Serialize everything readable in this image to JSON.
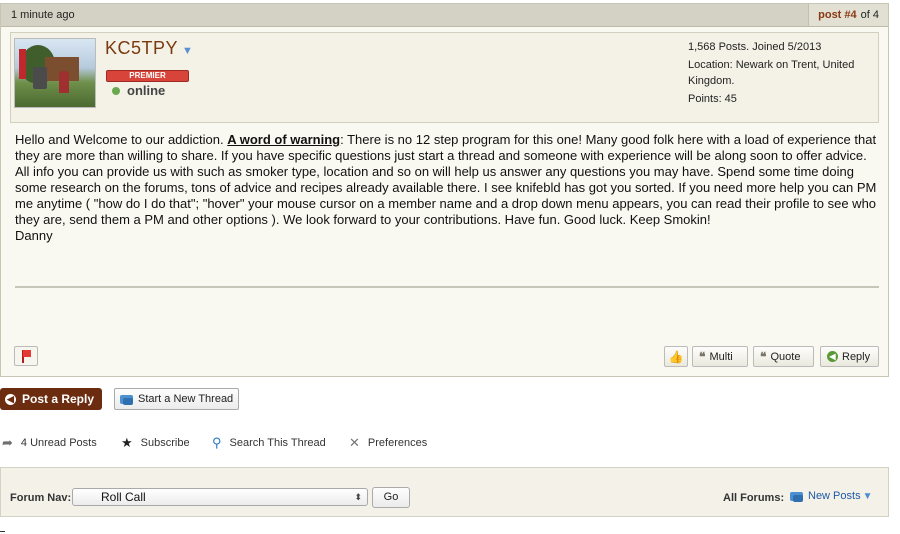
{
  "post": {
    "time_ago": "1 minute ago",
    "post_label": "post #4",
    "post_of": "of 4"
  },
  "user": {
    "name": "KC5TPY",
    "badge": "PREMIER",
    "status": "online",
    "posts_joined": "1,568 Posts. Joined 5/2013",
    "location": "Location: Newark on Trent, United Kingdom.",
    "points": "Points: 45"
  },
  "body": {
    "intro": "Hello and Welcome to our addiction.  ",
    "warning_link": "A word of warning",
    "text": ": There is no 12 step program for this one!  Many good folk here with a load of experience that they are more than willing to share.  If you have specific questions just start a thread and someone with experience will be along soon to offer advice.  All info you can provide us with such as smoker type, location and so on will help us answer any questions you may have.  Spend some time doing some research on the forums, tons of advice and recipes already available there.  I see knifebld has got you sorted.  If you need more help you can PM me anytime ( \"how do I do that\";  \"hover\" your mouse cursor on a member name and a drop down menu appears, you can read their profile to see who they are, send them a PM and other options ).  We look forward to your contributions.  Have fun.  Good luck.  Keep Smokin!",
    "signoff": "Danny"
  },
  "toolbar": {
    "multi": "Multi",
    "quote": "Quote",
    "reply": "Reply"
  },
  "thread_actions": {
    "post_reply": "Post a Reply",
    "new_thread": "Start a New Thread",
    "unread": "4 Unread Posts",
    "subscribe": "Subscribe",
    "search": "Search This Thread",
    "preferences": "Preferences"
  },
  "forum_nav": {
    "label": "Forum Nav:",
    "selected": "Roll Call",
    "go": "Go",
    "all_forums": "All Forums:",
    "new_posts": "New Posts"
  },
  "colors": {
    "accent": "#6b2c10",
    "link": "#1f5aa8",
    "online": "#6aa84f"
  }
}
